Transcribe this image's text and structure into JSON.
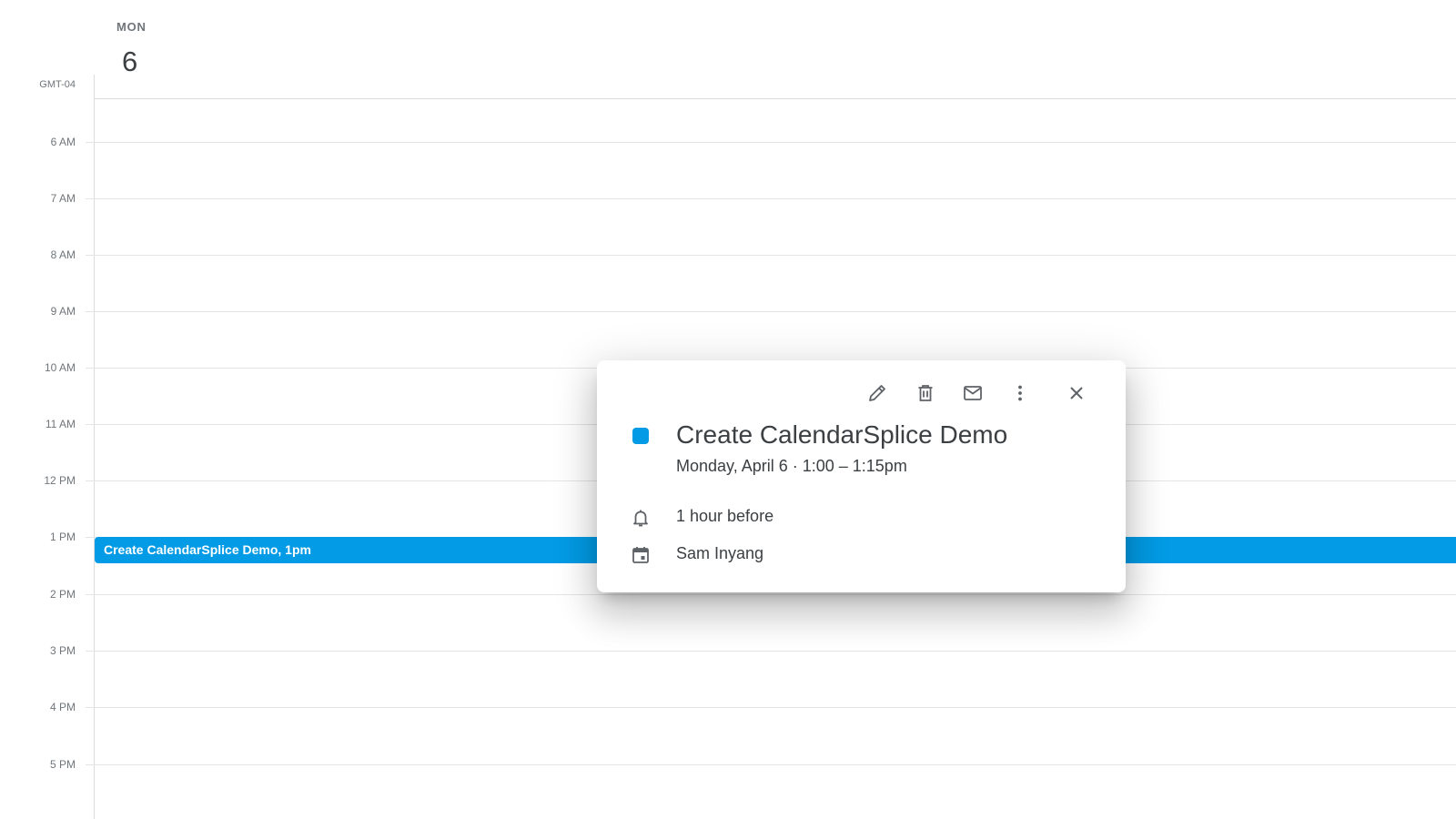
{
  "day_header": {
    "day_name": "MON",
    "day_number": "6"
  },
  "timezone_label": "GMT-04",
  "hours": [
    "6 AM",
    "7 AM",
    "8 AM",
    "9 AM",
    "10 AM",
    "11 AM",
    "12 PM",
    "1 PM",
    "2 PM",
    "3 PM",
    "4 PM",
    "5 PM"
  ],
  "event_chip": {
    "label": "Create CalendarSplice Demo, 1pm",
    "color": "#039be5"
  },
  "popover": {
    "toolbar": {
      "edit_icon": "pencil-icon",
      "delete_icon": "trash-icon",
      "email_icon": "mail-icon",
      "more_icon": "more-vert-icon",
      "close_icon": "close-icon"
    },
    "title": "Create CalendarSplice Demo",
    "color": "#039be5",
    "date_line": "Monday, April 6  ·  1:00 – 1:15pm",
    "reminder": "1 hour before",
    "calendar_owner": "Sam Inyang"
  }
}
